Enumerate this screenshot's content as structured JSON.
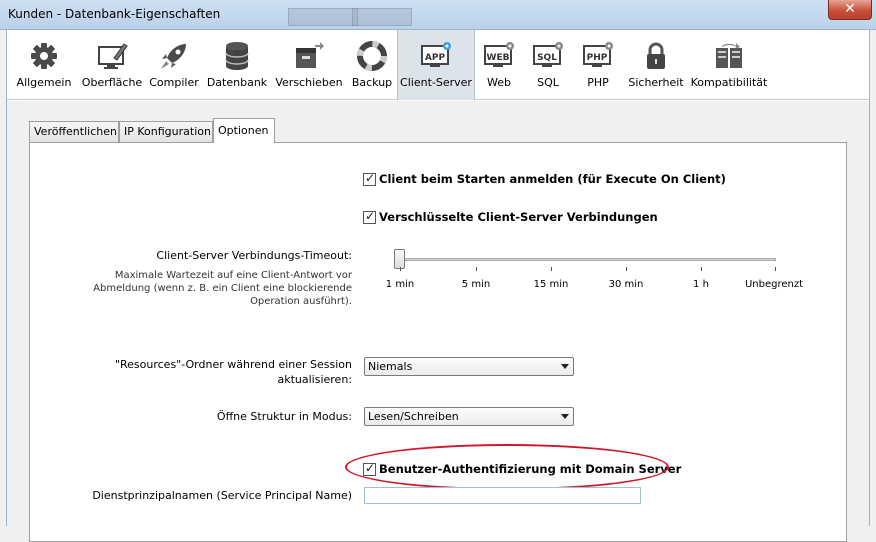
{
  "window": {
    "title": "Kunden - Datenbank-Eigenschaften",
    "close_symbol": "✕"
  },
  "toolbar": {
    "items": [
      {
        "label": "Allgemein",
        "icon": "gear-icon"
      },
      {
        "label": "Oberfläche",
        "icon": "monitor-pen-icon"
      },
      {
        "label": "Compiler",
        "icon": "rocket-icon"
      },
      {
        "label": "Datenbank",
        "icon": "database-icon"
      },
      {
        "label": "Verschieben",
        "icon": "box-arrow-icon"
      },
      {
        "label": "Backup",
        "icon": "lifebuoy-icon"
      },
      {
        "label": "Client-Server",
        "icon": "app-server-icon",
        "icon_text": "APP",
        "active": true
      },
      {
        "label": "Web",
        "icon": "web-server-icon",
        "icon_text": "WEB"
      },
      {
        "label": "SQL",
        "icon": "sql-server-icon",
        "icon_text": "SQL"
      },
      {
        "label": "PHP",
        "icon": "php-server-icon",
        "icon_text": "PHP"
      },
      {
        "label": "Sicherheit",
        "icon": "padlock-icon"
      },
      {
        "label": "Kompatibilität",
        "icon": "compatibility-icon"
      }
    ]
  },
  "tabs": [
    {
      "label": "Veröffentlichen"
    },
    {
      "label": "IP Konfiguration"
    },
    {
      "label": "Optionen",
      "active": true
    }
  ],
  "options": {
    "login_on_start": {
      "label": "Client beim Starten anmelden (für Execute On Client)",
      "checked": true
    },
    "encrypted": {
      "label": "Verschlüsselte Client-Server Verbindungen",
      "checked": true
    },
    "timeout": {
      "label": "Client-Server Verbindungs-Timeout:",
      "hint_line1": "Maximale Wartezeit auf eine Client-Antwort vor",
      "hint_line2": "Abmeldung (wenn z. B. ein Client eine blockierende",
      "hint_line3": "Operation ausführt).",
      "ticks": [
        "1 min",
        "5 min",
        "15 min",
        "30 min",
        "1 h",
        "Unbegrenzt"
      ],
      "selected_index": 0
    },
    "resources": {
      "label_line1": "\"Resources\"-Ordner während einer Session",
      "label_line2": "aktualisieren:",
      "value": "Niemals"
    },
    "structure": {
      "label": "Öffne Struktur in Modus:",
      "value": "Lesen/Schreiben"
    },
    "domain_auth": {
      "label": "Benutzer-Authentifizierung mit Domain Server",
      "checked": true
    },
    "spn": {
      "label": "Dienstprinzipalnamen (Service Principal Name)",
      "value": ""
    }
  },
  "colors": {
    "highlight_ellipse": "#d0172a",
    "active_tab_bg": "#dde3ea",
    "titlebar": "#c4d8ef"
  }
}
